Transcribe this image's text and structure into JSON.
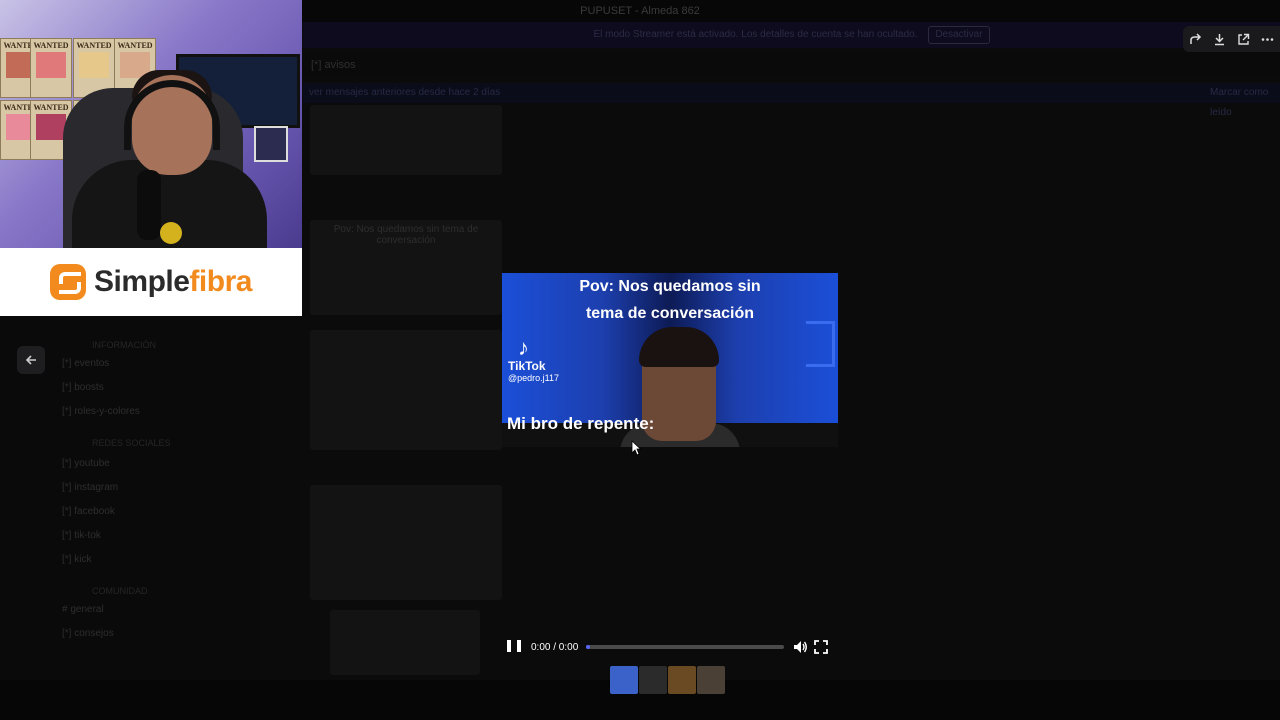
{
  "background": {
    "window_title": "PUPUSET - Almeda 862",
    "banner_text": "El modo Streamer está activado. Los detalles de cuenta se han ocultado.",
    "banner_button": "Desactivar",
    "channel_header": "[*] avisos",
    "strip_text": "ver mensajes anteriores desde hace 2 días",
    "strip_right": "Marcar como leído",
    "sidebar_channels": [
      "[*] eventos",
      "[*] boosts",
      "[*] roles-y-colores",
      "[*] youtube",
      "[*] instagram",
      "[*] facebook",
      "[*] tik-tok",
      "[*] kick",
      "# general",
      "[*] consejos"
    ],
    "sidebar_categories": [
      "INFORMACIÓN",
      "REDES SOCIALES",
      "COMUNIDAD"
    ],
    "thumb_caption": "Pov: Nos quedamos sin tema de conversación"
  },
  "toolbar": {
    "icons": [
      "share-icon",
      "download-icon",
      "open-external-icon",
      "more-icon"
    ]
  },
  "webcam": {
    "poster_text": "WANTED"
  },
  "sponsor": {
    "name_part1": "Simple",
    "name_part2": "fibra",
    "brand_color": "#f28a1e"
  },
  "video": {
    "caption_line1": "Pov: Nos quedamos sin",
    "caption_line2": "tema de conversación",
    "tiktok_label": "TikTok",
    "tiktok_user": "@pedro.j117",
    "subtitle": "Mi bro de repente:"
  },
  "player": {
    "time": "0:00 / 0:00",
    "progress": 0.02,
    "accent": "#5865f2"
  },
  "thumbnails": [
    {
      "color": "#3b62c9"
    },
    {
      "color": "#2b2b2b"
    },
    {
      "color": "#6a4a22"
    },
    {
      "color": "#4a4036"
    }
  ]
}
